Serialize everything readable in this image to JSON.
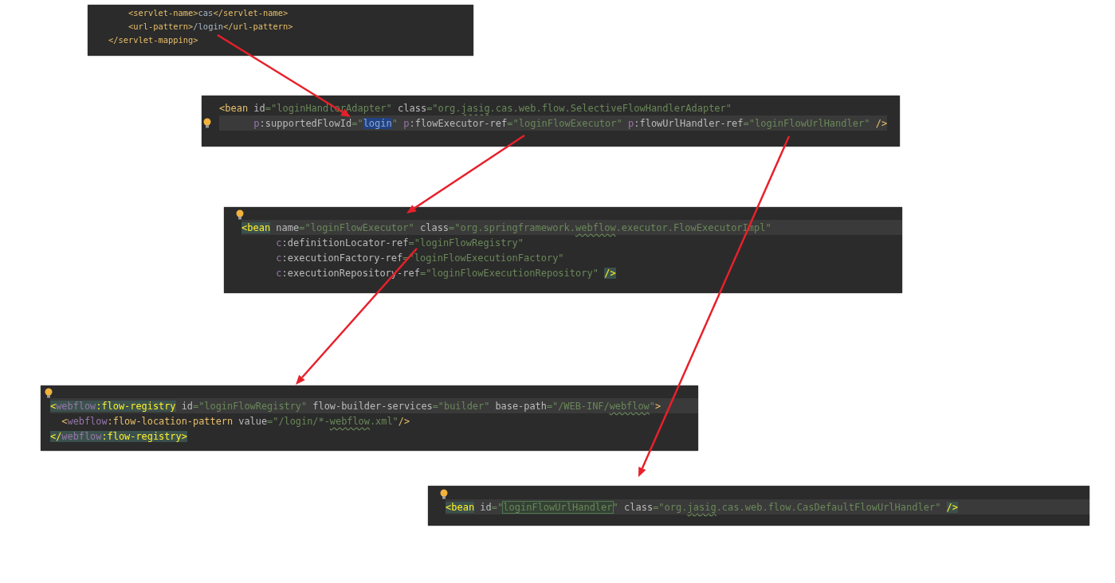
{
  "panels": [
    {
      "bulb_above": false,
      "lines": [
        {
          "current": false,
          "bulb": false,
          "tokens": [
            {
              "kind": "tag",
              "text": "    <servlet-name>"
            },
            {
              "kind": "text",
              "text": "cas"
            },
            {
              "kind": "tag",
              "text": "</servlet-name>"
            }
          ]
        },
        {
          "current": false,
          "bulb": false,
          "tokens": [
            {
              "kind": "tag",
              "text": "    <url-pattern>"
            },
            {
              "kind": "text",
              "text": "/login"
            },
            {
              "kind": "tag",
              "text": "</url-pattern>"
            }
          ]
        },
        {
          "current": false,
          "bulb": false,
          "tokens": [
            {
              "kind": "tag",
              "text": "</servlet-mapping>"
            }
          ]
        }
      ]
    },
    {
      "bulb_above": false,
      "lines": [
        {
          "current": false,
          "bulb": false,
          "tokens": [
            {
              "kind": "tag",
              "text": "<bean"
            },
            {
              "kind": "attr",
              "text": " id"
            },
            {
              "kind": "value",
              "text": "=\"loginHandlerAdapter\""
            },
            {
              "kind": "attr",
              "text": " class"
            },
            {
              "kind": "value",
              "text": "=\"org."
            },
            {
              "kind": "misspelt",
              "text": "jasig"
            },
            {
              "kind": "value",
              "text": ".cas.web.flow.SelectiveFlowHandlerAdapter\""
            }
          ]
        },
        {
          "current": true,
          "bulb": true,
          "tokens": [
            {
              "kind": "ns",
              "text": "      p"
            },
            {
              "kind": "attr",
              "text": ":supportedFlowId"
            },
            {
              "kind": "value",
              "text": "=\""
            },
            {
              "kind": "selected",
              "text": "login"
            },
            {
              "kind": "value",
              "text": "\""
            },
            {
              "kind": "ns",
              "text": " p"
            },
            {
              "kind": "attr",
              "text": ":flowExecutor-ref"
            },
            {
              "kind": "value",
              "text": "=\"loginFlowExecutor\""
            },
            {
              "kind": "ns",
              "text": " p"
            },
            {
              "kind": "attr",
              "text": ":flowUrlHandler-ref"
            },
            {
              "kind": "value",
              "text": "=\"loginFlowUrlHandler\""
            },
            {
              "kind": "tag",
              "text": " />"
            }
          ]
        }
      ]
    },
    {
      "bulb_above": true,
      "lines": [
        {
          "current": true,
          "bulb": false,
          "tokens": [
            {
              "kind": "paired",
              "text": "<bean"
            },
            {
              "kind": "attr",
              "text": " name"
            },
            {
              "kind": "value",
              "text": "=\"loginFlowExecutor\""
            },
            {
              "kind": "attr",
              "text": " class"
            },
            {
              "kind": "value",
              "text": "=\"org.springframework."
            },
            {
              "kind": "misspelt",
              "text": "webflow"
            },
            {
              "kind": "value",
              "text": ".executor.FlowExecutorImpl\""
            }
          ]
        },
        {
          "current": false,
          "bulb": false,
          "tokens": [
            {
              "kind": "ns",
              "text": "      c"
            },
            {
              "kind": "attr",
              "text": ":definitionLocator-ref"
            },
            {
              "kind": "value",
              "text": "=\"loginFlowRegistry\""
            }
          ]
        },
        {
          "current": false,
          "bulb": false,
          "tokens": [
            {
              "kind": "ns",
              "text": "      c"
            },
            {
              "kind": "attr",
              "text": ":executionFactory-ref"
            },
            {
              "kind": "value",
              "text": "=\"loginFlowExecutionFactory\""
            }
          ]
        },
        {
          "current": false,
          "bulb": false,
          "tokens": [
            {
              "kind": "ns",
              "text": "      c"
            },
            {
              "kind": "attr",
              "text": ":executionRepository-ref"
            },
            {
              "kind": "value",
              "text": "=\"loginFlowExecutionRepository\" "
            },
            {
              "kind": "paired",
              "text": "/>"
            }
          ]
        }
      ]
    },
    {
      "bulb_above": true,
      "lines": [
        {
          "current": true,
          "bulb": false,
          "tokens": [
            {
              "kind": "paired",
              "text": "<"
            },
            {
              "kind": "pairedns",
              "text": "webflow"
            },
            {
              "kind": "paired",
              "text": ":flow-registry"
            },
            {
              "kind": "attr",
              "text": " id"
            },
            {
              "kind": "value",
              "text": "=\"loginFlowRegistry\""
            },
            {
              "kind": "attr",
              "text": " flow-builder-services"
            },
            {
              "kind": "value",
              "text": "=\"builder\""
            },
            {
              "kind": "attr",
              "text": " base-path"
            },
            {
              "kind": "value",
              "text": "=\"/WEB-INF/"
            },
            {
              "kind": "misspelt",
              "text": "webflow"
            },
            {
              "kind": "value",
              "text": "\""
            },
            {
              "kind": "tag",
              "text": ">"
            }
          ]
        },
        {
          "current": false,
          "bulb": false,
          "tokens": [
            {
              "kind": "tag",
              "text": "  <"
            },
            {
              "kind": "ns",
              "text": "webflow"
            },
            {
              "kind": "tag",
              "text": ":flow-location-pattern"
            },
            {
              "kind": "attr",
              "text": " value"
            },
            {
              "kind": "value",
              "text": "=\"/login/*-"
            },
            {
              "kind": "misspelt",
              "text": "webflow"
            },
            {
              "kind": "value",
              "text": ".xml\""
            },
            {
              "kind": "tag",
              "text": "/>"
            }
          ]
        },
        {
          "current": false,
          "bulb": false,
          "tokens": [
            {
              "kind": "paired",
              "text": "</"
            },
            {
              "kind": "pairedns",
              "text": "webflow"
            },
            {
              "kind": "paired",
              "text": ":flow-registry>"
            }
          ]
        }
      ]
    },
    {
      "bulb_above": true,
      "lines": [
        {
          "current": true,
          "bulb": false,
          "tokens": [
            {
              "kind": "paired",
              "text": "<bean"
            },
            {
              "kind": "attr",
              "text": " id"
            },
            {
              "kind": "value",
              "text": "=\""
            },
            {
              "kind": "matched",
              "text": "loginFlowUrlHandler"
            },
            {
              "kind": "value",
              "text": "\""
            },
            {
              "kind": "attr",
              "text": " class"
            },
            {
              "kind": "value",
              "text": "=\"org."
            },
            {
              "kind": "misspelt",
              "text": "jasig"
            },
            {
              "kind": "value",
              "text": ".cas.web.flow.CasDefaultFlowUrlHandler\" "
            },
            {
              "kind": "paired",
              "text": "/>"
            }
          ]
        }
      ]
    }
  ]
}
